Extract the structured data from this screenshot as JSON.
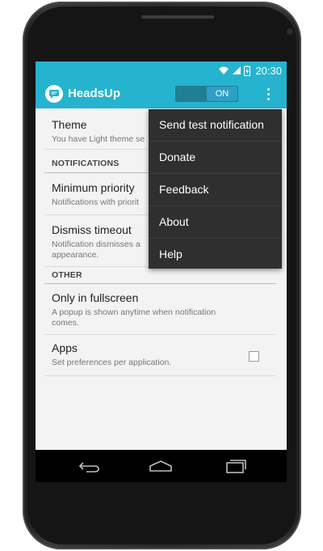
{
  "status_bar": {
    "time": "20:30",
    "icons": [
      "wifi-icon",
      "signal-icon",
      "battery-icon"
    ]
  },
  "action_bar": {
    "title": "HeadsUp",
    "logo_icon": "chat-bubble-icon",
    "toggle_state": "ON",
    "overflow_icon": "more-vert-icon"
  },
  "preferences": {
    "theme": {
      "title": "Theme",
      "summary": "You have Light theme se"
    },
    "categories": {
      "notifications": "NOTIFICATIONS",
      "other": "OTHER"
    },
    "min_priority": {
      "title": "Minimum priority",
      "summary": "Notifications with priorit"
    },
    "dismiss_timeout": {
      "title": "Dismiss timeout",
      "summary_line1": "Notification dismisses a",
      "summary_line2": "appearance."
    },
    "fullscreen": {
      "title": "Only in fullscreen",
      "summary_line1": "A popup is shown anytime when notification",
      "summary_line2": "comes.",
      "checked": false
    },
    "apps": {
      "title": "Apps",
      "summary": "Set preferences per application."
    }
  },
  "overflow_menu": {
    "items": [
      {
        "label": "Send test notification"
      },
      {
        "label": "Donate"
      },
      {
        "label": "Feedback"
      },
      {
        "label": "About"
      },
      {
        "label": "Help"
      }
    ]
  },
  "nav_bar": {
    "icons": [
      "back-icon",
      "home-icon",
      "recents-icon"
    ]
  },
  "colors": {
    "accent": "#25b3cf",
    "menu_bg": "#2f2f2f",
    "screen_bg": "#f3f3f3"
  }
}
